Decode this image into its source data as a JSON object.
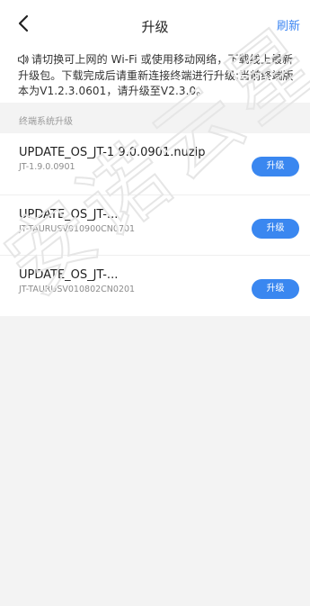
{
  "header": {
    "title": "升级",
    "refresh_label": "刷新"
  },
  "notice": {
    "text": "请切换可上网的 Wi-Fi 或使用移动网络，下载线上最新升级包。下载完成后请重新连接终端进行升级;当前终端版本为V1.2.3.0601，请升级至V2.3.0。"
  },
  "section": {
    "label": "终端系统升级"
  },
  "packages": [
    {
      "name": "UPDATE_OS_JT-1.9.0.0901.nuzip",
      "version": "JT-1.9.0.0901",
      "button": "升级"
    },
    {
      "name": "UPDATE_OS_JT-...",
      "version": "JT-TAURUSV010900CN0701",
      "button": "升级"
    },
    {
      "name": "UPDATE_OS_JT-...",
      "version": "JT-TAURUSV010802CN0201",
      "button": "升级"
    }
  ],
  "colors": {
    "accent": "#3a87f0",
    "background": "#f3f3f3"
  },
  "watermark": {
    "text": "安诺云星"
  }
}
